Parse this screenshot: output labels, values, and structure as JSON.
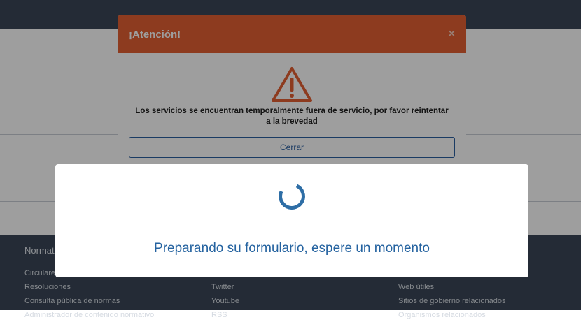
{
  "footer": {
    "columns": [
      {
        "title": "Normativa",
        "items": [
          "Circulares",
          "Resoluciones",
          "Consulta pública de normas",
          "Administrador de contenido normativo"
        ]
      },
      {
        "title": "",
        "items": [
          "",
          "Twitter",
          "Youtube",
          "RSS"
        ]
      },
      {
        "title": "",
        "items": [
          "",
          "Web útiles",
          "Sitios de gobierno relacionados",
          "Organismos relacionados"
        ]
      }
    ]
  },
  "alert": {
    "title": "¡Atención!",
    "close_symbol": "×",
    "icon": "warning-triangle-icon",
    "message": "Los servicios se encuentran temporalmente fuera de servicio, por favor reintentar a la brevedad",
    "button_label": "Cerrar",
    "header_color": "#e45f32",
    "icon_color": "#e45f32"
  },
  "loading": {
    "message": "Preparando su formulario, espere un momento",
    "spinner_color": "#2e6ea6"
  }
}
